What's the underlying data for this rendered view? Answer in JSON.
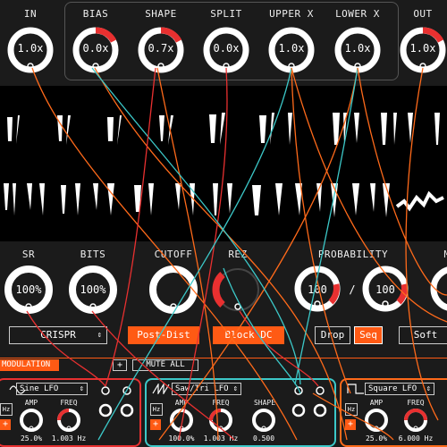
{
  "top_knobs": [
    {
      "label": "IN",
      "value": "1.0x",
      "fill": 0.0
    },
    {
      "label": "BIAS",
      "value": "0.0x",
      "fill": 0.12
    },
    {
      "label": "SHAPE",
      "value": "0.7x",
      "fill": 0.1
    },
    {
      "label": "SPLIT",
      "value": "0.0x",
      "fill": 0.0
    },
    {
      "label": "UPPER X",
      "value": "1.0x",
      "fill": 0.0
    },
    {
      "label": "LOWER X",
      "value": "1.0x",
      "fill": 0.0
    },
    {
      "label": "OUT",
      "value": "1.0x",
      "fill": 0.12
    }
  ],
  "mid_knobs": [
    {
      "label": "SR",
      "value": "100%"
    },
    {
      "label": "BITS",
      "value": "100%"
    },
    {
      "label": "CUTOFF",
      "value": ""
    },
    {
      "label": "REZ",
      "value": ""
    }
  ],
  "probability": {
    "label": "PROBABILITY",
    "value1": "100",
    "sep": "/",
    "value2": "100",
    "next_label": "M"
  },
  "buttons": {
    "mode_select": "CRISPR",
    "post_dist": "Post-Dist",
    "block_dc": "Block DC",
    "drop": "Drop",
    "seq": "Seq",
    "soft": "Soft"
  },
  "modulation": {
    "title": "MODULATION",
    "add": "+",
    "mute_all": "MUTE ALL",
    "lfos": [
      {
        "type": "Sine LFO",
        "amp_label": "AMP",
        "freq_label": "FREQ",
        "amp": "25.0%",
        "freq": "1.003 Hz",
        "hz": "Hz",
        "color": "#e83030"
      },
      {
        "type": "Saw/Tri LFO",
        "amp_label": "AMP",
        "freq_label": "FREQ",
        "shape_label": "SHAPE",
        "amp": "100.0%",
        "freq": "1.003 Hz",
        "shape": "0.500",
        "hz": "Hz",
        "color": "#3cc8c8"
      },
      {
        "type": "Square LFO",
        "amp_label": "AMP",
        "freq_label": "FREQ",
        "amp": "25.0%",
        "freq": "6.000 Hz",
        "hz": "Hz",
        "color": "#ff6a1a"
      }
    ]
  },
  "colors": {
    "accent": "#ff5a14",
    "red": "#e83030",
    "teal": "#3cc8c8",
    "bg": "#1b1b1b"
  }
}
